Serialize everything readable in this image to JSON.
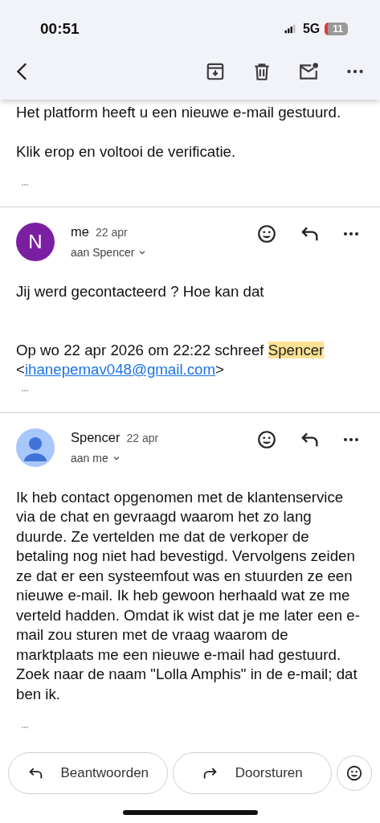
{
  "status_bar": {
    "time": "00:51",
    "network": "5G",
    "battery": "11",
    "battery_low": true
  },
  "toolbar": {
    "actions": [
      {
        "kind": "archive"
      },
      {
        "kind": "delete"
      },
      {
        "kind": "unread"
      },
      {
        "kind": "more"
      }
    ]
  },
  "messages": [
    {
      "paragraphs": [
        "Het platform heeft u een nieuwe e-mail gestuurd.",
        "Klik erop en voltooi de verificatie."
      ],
      "has_quoted": true
    },
    {
      "sender": "me",
      "date": "22 apr",
      "recipient": "aan Spencer",
      "avatar": {
        "kind": "letter",
        "letter": "N",
        "color": "#7b1fa2"
      },
      "paragraphs": [
        "Jij werd gecontacteerd ? Hoe kan dat"
      ],
      "quote": {
        "prefix": "Op wo 22 apr 2026 om 22:22 schreef ",
        "highlight": "Spencer",
        "open": "<",
        "email": "ihanepemav048@gmail.com",
        "close": ">"
      },
      "has_quoted": true
    },
    {
      "sender": "Spencer",
      "date": "22 apr",
      "recipient": "aan me",
      "avatar": {
        "kind": "person",
        "color": "#a8c7fa"
      },
      "paragraphs": [
        "Ik heb contact opgenomen met de klantenservice via de chat en gevraagd waarom het zo lang duurde. Ze vertelden me dat de verkoper de betaling nog niet had bevestigd. Vervolgens zeiden ze dat er een systeemfout was en stuurden ze een nieuwe e-mail. Ik heb gewoon herhaald wat ze me verteld hadden. Omdat ik wist dat je me later een e-mail zou sturen met de vraag waarom de marktplaats me een nieuwe e-mail had gestuurd. Zoek naar de naam \"Lolla Amphis\" in de e-mail; dat ben ik."
      ],
      "has_quoted": true
    }
  ],
  "bottom_actions": [
    {
      "kind": "reply",
      "label": "Beantwoorden"
    },
    {
      "kind": "forward",
      "label": "Doorsturen"
    },
    {
      "kind": "react"
    }
  ]
}
